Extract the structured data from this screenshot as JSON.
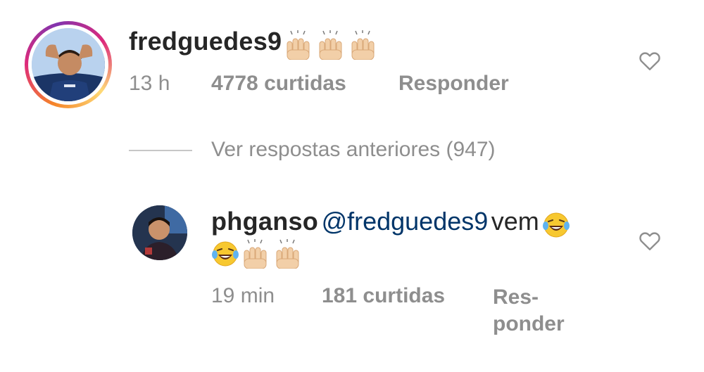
{
  "comment_main": {
    "username": "fredguedes9",
    "time": "13 h",
    "likes": "4778 curtidas",
    "reply_label": "Responder"
  },
  "view_previous": {
    "label": "Ver respostas anteriores (947)"
  },
  "reply": {
    "username": "phganso",
    "mention": "@fredguedes9",
    "text": "vem",
    "time": "19 min",
    "likes": "181 curtidas",
    "reply_label_line1": "Res-",
    "reply_label_line2": "ponder"
  },
  "icons": {
    "like": "heart-outline-icon",
    "emoji_raised_hands": "raising-hands-emoji",
    "emoji_laughing": "tears-of-joy-emoji"
  },
  "colors": {
    "text": "#262626",
    "muted": "#8e8e8e",
    "mention": "#003569",
    "divider": "#c7c7c7"
  }
}
